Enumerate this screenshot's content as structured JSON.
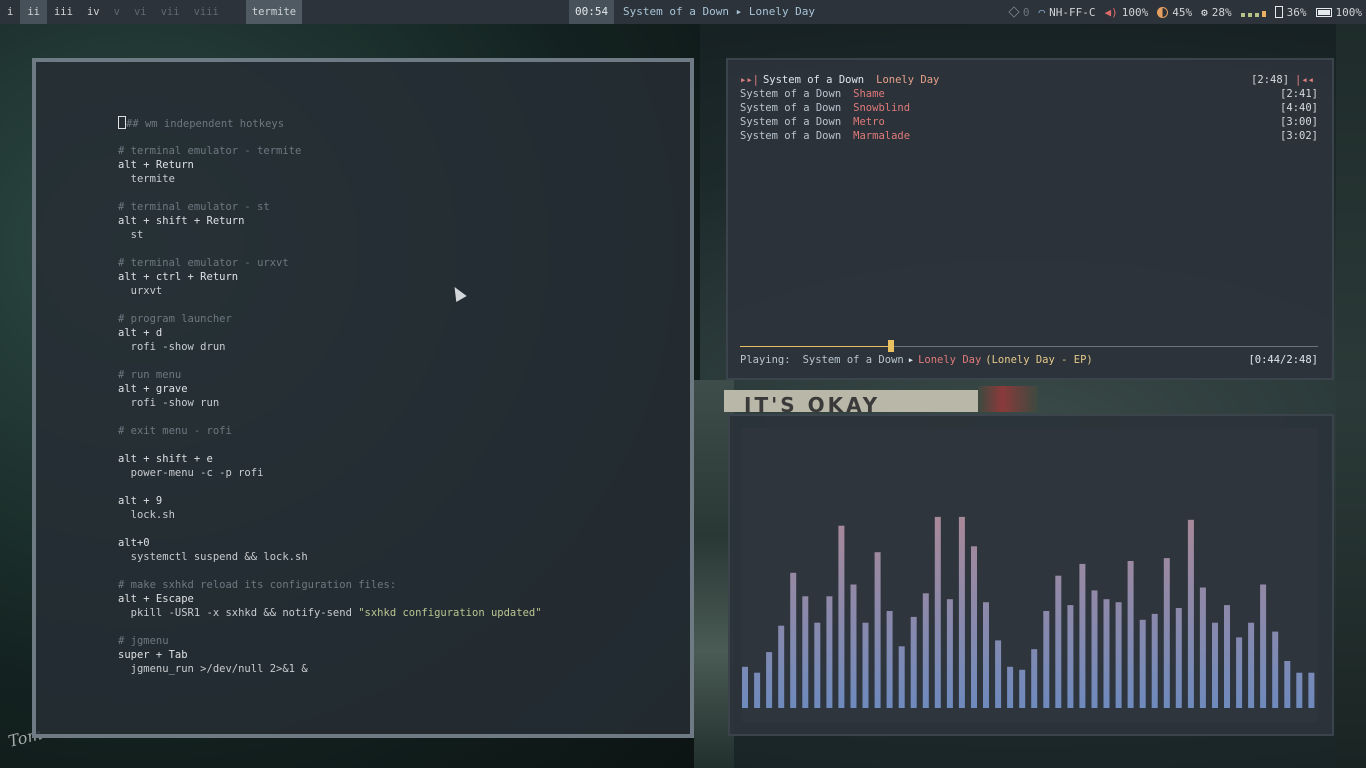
{
  "bar": {
    "workspaces": [
      {
        "label": "i",
        "state": "normal"
      },
      {
        "label": "ii",
        "state": "focused"
      },
      {
        "label": "iii",
        "state": "normal"
      },
      {
        "label": "iv",
        "state": "normal"
      },
      {
        "label": "v",
        "state": "dim"
      },
      {
        "label": "vi",
        "state": "dim"
      },
      {
        "label": "vii",
        "state": "dim"
      },
      {
        "label": "viii",
        "state": "dim"
      }
    ],
    "window_title": "termite",
    "clock": "00:54",
    "now_playing": "System of a Down ▸ Lonely Day",
    "status": {
      "updates": "0",
      "wifi": "NH-FF-C",
      "volume": "100%",
      "brightness": "45%",
      "cpu": "28%",
      "disk": "36%",
      "battery": "100%"
    },
    "icons": {
      "updates": "package-icon",
      "wifi": "wifi-icon",
      "volume": "volume-icon",
      "brightness": "brightness-icon",
      "cpu": "cpu-icon",
      "memory": "memory-bars-icon",
      "disk": "disk-icon",
      "battery": "battery-icon"
    },
    "colors": {
      "background": "#2c333a",
      "focused": "#46515a",
      "accent": "#a8c3d6"
    }
  },
  "editor": {
    "lines": [
      {
        "t": "comment",
        "text": "### wm independent hotkeys",
        "cursor": true
      },
      {
        "t": "blank",
        "text": ""
      },
      {
        "t": "comment",
        "text": "# terminal emulator - termite"
      },
      {
        "t": "key",
        "text": "alt + Return"
      },
      {
        "t": "cmd",
        "text": "  termite"
      },
      {
        "t": "blank",
        "text": ""
      },
      {
        "t": "comment",
        "text": "# terminal emulator - st"
      },
      {
        "t": "key",
        "text": "alt + shift + Return"
      },
      {
        "t": "cmd",
        "text": "  st"
      },
      {
        "t": "blank",
        "text": ""
      },
      {
        "t": "comment",
        "text": "# terminal emulator - urxvt"
      },
      {
        "t": "key",
        "text": "alt + ctrl + Return"
      },
      {
        "t": "cmd",
        "text": "  urxvt"
      },
      {
        "t": "blank",
        "text": ""
      },
      {
        "t": "comment",
        "text": "# program launcher"
      },
      {
        "t": "key",
        "text": "alt + d"
      },
      {
        "t": "cmd",
        "text": "  rofi -show drun"
      },
      {
        "t": "blank",
        "text": ""
      },
      {
        "t": "comment",
        "text": "# run menu"
      },
      {
        "t": "key",
        "text": "alt + grave"
      },
      {
        "t": "cmd",
        "text": "  rofi -show run"
      },
      {
        "t": "blank",
        "text": ""
      },
      {
        "t": "comment",
        "text": "# exit menu - rofi"
      },
      {
        "t": "blank",
        "text": ""
      },
      {
        "t": "key",
        "text": "alt + shift + e"
      },
      {
        "t": "cmd",
        "text": "  power-menu -c -p rofi"
      },
      {
        "t": "blank",
        "text": ""
      },
      {
        "t": "key",
        "text": "alt + 9"
      },
      {
        "t": "cmd",
        "text": "  lock.sh"
      },
      {
        "t": "blank",
        "text": ""
      },
      {
        "t": "key",
        "text": "alt+0"
      },
      {
        "t": "cmd",
        "text": "  systemctl suspend && lock.sh"
      },
      {
        "t": "blank",
        "text": ""
      },
      {
        "t": "comment",
        "text": "# make sxhkd reload its configuration files:"
      },
      {
        "t": "key",
        "text": "alt + Escape"
      },
      {
        "t": "cmd",
        "text": "  pkill -USR1 -x sxhkd && notify-send ",
        "str": "\"sxhkd configuration updated\""
      },
      {
        "t": "blank",
        "text": ""
      },
      {
        "t": "comment",
        "text": "# jgmenu"
      },
      {
        "t": "key",
        "text": "super + Tab"
      },
      {
        "t": "cmd",
        "text": "  jgmenu_run >/dev/null 2>&1 &"
      }
    ]
  },
  "player": {
    "playlist": [
      {
        "artist": "System of a Down",
        "title": "Lonely Day",
        "time": "[2:48]",
        "current": true,
        "current_icon": "▸▸|",
        "repeat_icon": "|◂◂"
      },
      {
        "artist": "System of a Down",
        "title": "Shame",
        "time": "[2:41]"
      },
      {
        "artist": "System of a Down",
        "title": "Snowblind",
        "time": "[4:40]"
      },
      {
        "artist": "System of a Down",
        "title": "Metro",
        "time": "[3:00]"
      },
      {
        "artist": "System of a Down",
        "title": "Marmalade",
        "time": "[3:02]"
      }
    ],
    "progress": 0.262,
    "playing_label": "Playing:",
    "playing_artist": "System of a Down",
    "playing_arrow": "▸",
    "playing_title": "Lonely Day",
    "playing_album": "(Lonely Day - EP)",
    "position": "[0:44/2:48]"
  },
  "visualizer": {
    "bars": [
      0.14,
      0.12,
      0.19,
      0.28,
      0.46,
      0.38,
      0.29,
      0.38,
      0.62,
      0.42,
      0.29,
      0.53,
      0.33,
      0.21,
      0.31,
      0.39,
      0.65,
      0.37,
      0.65,
      0.55,
      0.36,
      0.23,
      0.14,
      0.13,
      0.2,
      0.33,
      0.45,
      0.35,
      0.49,
      0.4,
      0.37,
      0.36,
      0.5,
      0.3,
      0.32,
      0.51,
      0.34,
      0.64,
      0.41,
      0.29,
      0.35,
      0.24,
      0.29,
      0.42,
      0.26,
      0.16,
      0.12,
      0.12
    ],
    "color_low": "#6a8ac0",
    "color_high": "#c48888"
  }
}
